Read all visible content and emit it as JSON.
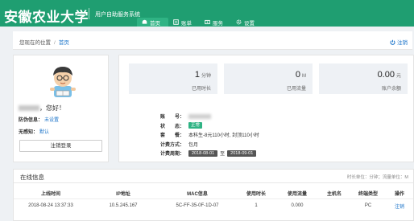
{
  "header": {
    "logo": "安徽农业大学",
    "subtitle": "用户自助服务系统",
    "nav": [
      {
        "label": "首页",
        "icon": "home-icon",
        "active": true
      },
      {
        "label": "账单",
        "icon": "bill-icon",
        "active": false
      },
      {
        "label": "服务",
        "icon": "service-icon",
        "active": false
      },
      {
        "label": "设置",
        "icon": "gear-icon",
        "active": false
      }
    ],
    "accent": "#1f9e71"
  },
  "breadcrumb": {
    "location": "您现在的位置",
    "home": "首页",
    "logout": "注销"
  },
  "user": {
    "greeting_suffix": "，您好！",
    "security_label": "防伪信息：",
    "security_value": "未设置",
    "perception_label": "无感知：",
    "perception_value": "默认",
    "logout_button": "注销登录"
  },
  "stats": [
    {
      "value": "1",
      "unit": "分钟",
      "label": "已用时长"
    },
    {
      "value": "0",
      "unit": "M",
      "label": "已用流量"
    },
    {
      "value": "0.00",
      "unit": "元",
      "label": "账户余额"
    }
  ],
  "account": {
    "account_label": "账　　号：",
    "status_label": "状　　态：",
    "status_value": "正常",
    "package_label": "套　　餐：",
    "package_value": "本科生-8元110小时, 封顶110小时",
    "billing_label": "计费方式：",
    "billing_value": "包月",
    "period_label": "计费周期：",
    "period_start": "2018-08-01",
    "period_to": "至",
    "period_end": "2018-09-01"
  },
  "online": {
    "title": "在线信息",
    "unit_note": "时长单位：分钟；流量单位：M",
    "columns": [
      "上线时间",
      "IP地址",
      "MAC信息",
      "使用时长",
      "使用流量",
      "主机名",
      "终端类型",
      "操作"
    ],
    "rows": [
      {
        "time": "2018-08-24 13:37:33",
        "ip": "10.5.245.167",
        "mac": "5C-FF-35-0F-1D-07",
        "duration": "1",
        "traffic": "0.000",
        "host": "",
        "terminal": "PC",
        "action": "注销"
      }
    ]
  }
}
